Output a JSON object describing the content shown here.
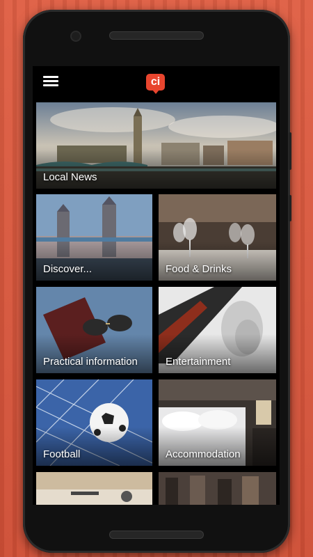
{
  "app": {
    "logo_text": "ci",
    "accent_color": "#e8452e"
  },
  "tiles": [
    {
      "label": "Local News",
      "icon": "london-skyline-photo"
    },
    {
      "label": "Discover...",
      "icon": "tower-bridge-photo"
    },
    {
      "label": "Food & Drinks",
      "icon": "wine-glasses-photo"
    },
    {
      "label": "Practical information",
      "icon": "passport-sunglasses-photo"
    },
    {
      "label": "Entertainment",
      "icon": "guitar-photo"
    },
    {
      "label": "Football",
      "icon": "football-net-photo"
    },
    {
      "label": "Accommodation",
      "icon": "hotel-bed-photo"
    },
    {
      "label": "",
      "icon": "desk-photo"
    },
    {
      "label": "",
      "icon": "gym-photo"
    }
  ]
}
